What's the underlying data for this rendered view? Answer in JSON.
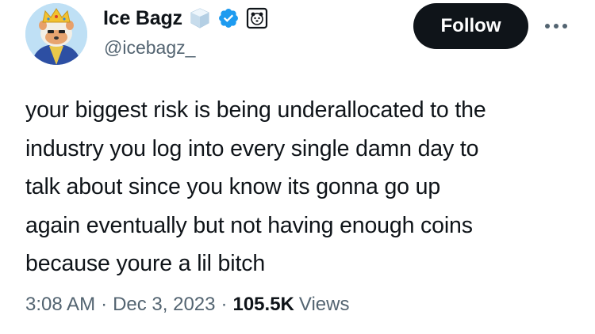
{
  "author": {
    "display_name": "Ice Bagz",
    "handle": "@icebagz_",
    "badges": [
      "ice-cube-emoji-icon",
      "verified-check-icon",
      "affiliate-badge-icon"
    ],
    "verified_color": "#1d9bf0"
  },
  "actions": {
    "follow_label": "Follow",
    "more_icon": "more-horizontal-icon"
  },
  "tweet": {
    "text": "your biggest risk is being underallocated to the\nindustry you log into every single damn day to\ntalk about since you know its gonna go up\nagain eventually but not having enough coins\nbecause youre a lil bitch"
  },
  "meta": {
    "time": "3:08 AM",
    "separator": "·",
    "date": "Dec 3, 2023",
    "views_count": "105.5K",
    "views_label": "Views"
  },
  "colors": {
    "text_primary": "#0f1419",
    "text_secondary": "#536471",
    "follow_bg": "#0f1419",
    "verified_blue": "#1d9bf0"
  }
}
